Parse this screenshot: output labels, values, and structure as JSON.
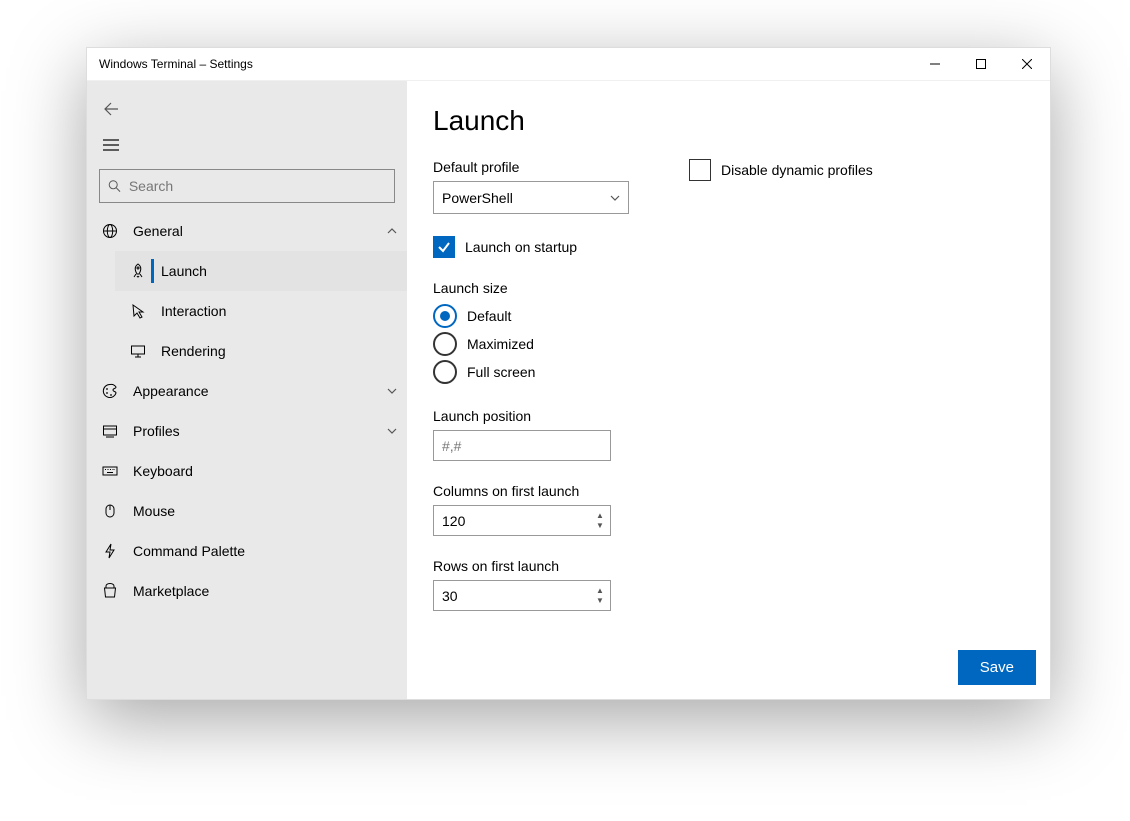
{
  "window": {
    "title": "Windows Terminal – Settings"
  },
  "sidebar": {
    "search_placeholder": "Search",
    "items": {
      "general": "General",
      "launch": "Launch",
      "interaction": "Interaction",
      "rendering": "Rendering",
      "appearance": "Appearance",
      "profiles": "Profiles",
      "keyboard": "Keyboard",
      "mouse": "Mouse",
      "command_palette": "Command Palette",
      "marketplace": "Marketplace"
    }
  },
  "page": {
    "title": "Launch",
    "default_profile_label": "Default profile",
    "default_profile_value": "PowerShell",
    "disable_dynamic_profiles_label": "Disable dynamic profiles",
    "disable_dynamic_profiles_checked": false,
    "launch_on_startup_label": "Launch on startup",
    "launch_on_startup_checked": true,
    "launch_size_label": "Launch size",
    "launch_size_options": {
      "default": "Default",
      "maximized": "Maximized",
      "fullscreen": "Full screen"
    },
    "launch_size_selected": "default",
    "launch_position_label": "Launch position",
    "launch_position_placeholder": "#,#",
    "launch_position_value": "",
    "columns_label": "Columns on first launch",
    "columns_value": "120",
    "rows_label": "Rows on first launch",
    "rows_value": "30",
    "save_label": "Save"
  }
}
